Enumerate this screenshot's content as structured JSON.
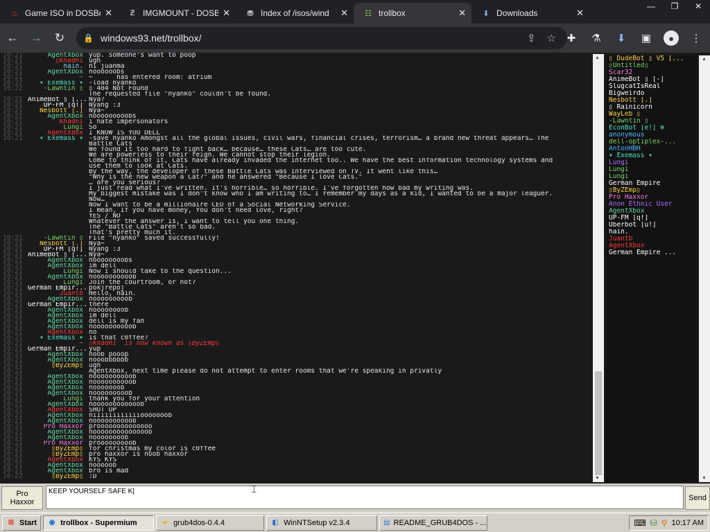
{
  "browser": {
    "tabs": [
      {
        "title": "Game ISO in DOSBo",
        "icon": "dosbox-favicon-icon",
        "active": false
      },
      {
        "title": "IMGMOUNT - DOSB",
        "icon": "dosbox-wiki-favicon-icon",
        "active": false
      },
      {
        "title": "Index of /isos/wind",
        "icon": "archive-favicon-icon",
        "active": false
      },
      {
        "title": "trollbox",
        "icon": "trollbox-favicon-icon",
        "active": true
      },
      {
        "title": "Downloads",
        "icon": "download-icon",
        "active": false
      }
    ],
    "url": "windows93.net/trollbox/"
  },
  "chat": [
    {
      "time": "10:21",
      "nick": "AgentXbox",
      "color": "#66d9a6",
      "msg": "yup. someone's want to poop"
    },
    {
      "time": "10:21",
      "nick": "▯Khadhi",
      "color": "#ff3b3b",
      "msg": "ugh"
    },
    {
      "time": "10:21",
      "nick": "hain.",
      "color": "#7fd3ff",
      "msg": "hi juanma"
    },
    {
      "time": "10:21",
      "nick": "AgentXbox",
      "color": "#66d9a6",
      "msg": "noooooobs"
    },
    {
      "time": "10:21",
      "nick": "~",
      "color": "#888888",
      "msg": "~      has entered room: atrium",
      "bold": "atrium"
    },
    {
      "time": "10:22",
      "nick": "▾ Exemass ▾",
      "color": "#50e3c2",
      "msg": "-load nyanko"
    },
    {
      "time": "10:22",
      "nick": "-Lawntin ▯",
      "color": "#7fd36b",
      "msg": "▯ 404 Not Found"
    },
    {
      "time": "",
      "nick": "",
      "color": "#ffffff",
      "msg": "The requested file \"nyanko\" couldn't be found."
    },
    {
      "time": "10:21",
      "nick": "AnimeBot ▯ [...",
      "color": "#ffffff",
      "msg": "Nya?"
    },
    {
      "time": "10:21",
      "nick": "UP-FM [q!]",
      "color": "#ffffff",
      "msg": "Nyang :3"
    },
    {
      "time": "10:21",
      "nick": "Nesbott [.]",
      "color": "#ffd24a",
      "msg": "Nya~"
    },
    {
      "time": "10:21",
      "nick": "AgentXbox",
      "color": "#66d9a6",
      "msg": "nooooooooobs"
    },
    {
      "time": "10:21",
      "nick": "Khadhi",
      "color": "#ff3b3b",
      "msg": "i hate impersonators"
    },
    {
      "time": "10:21",
      "nick": "Lungi",
      "color": "#7fd36b",
      "msg": "So"
    },
    {
      "time": "10:21",
      "nick": "AgentXbox",
      "color": "#ff3b3b",
      "msg": "I KNOW IS YOU DELL"
    },
    {
      "time": "10:21",
      "nick": "▾ Exemass ▾",
      "color": "#50e3c2",
      "msg": "-save nyanko Amongst all the global issues, civil wars, financial crises, terrorism… a brand new threat appears… The"
    },
    {
      "time": "",
      "nick": "",
      "color": "#ffffff",
      "msg": "Battle Cats"
    },
    {
      "time": "",
      "nick": "",
      "color": "#ffffff",
      "msg": "We found it too hard to fight back… because… these Cats… are too cute."
    },
    {
      "time": "",
      "nick": "",
      "color": "#ffffff",
      "msg": "We are powerless to their reign. We cannot stop their legion."
    },
    {
      "time": "",
      "nick": "",
      "color": "#ffffff",
      "msg": "Come to think of it, Cats have already invaded the internet too.. We have the best information technology systems and"
    },
    {
      "time": "",
      "nick": "",
      "color": "#ffffff",
      "msg": "use them to look at Cats."
    },
    {
      "time": "",
      "nick": "",
      "color": "#ffffff",
      "msg": "By the way, the developer of these Battle Cats was interviewed on TV. It went like this…"
    },
    {
      "time": "",
      "nick": "",
      "color": "#ffffff",
      "msg": "\"Why is the new weapon a Cat?\" and he answered \"Because I love Cats.\""
    },
    {
      "time": "",
      "nick": "",
      "color": "#ffffff",
      "msg": "… are you serious?"
    },
    {
      "time": "",
      "nick": "",
      "color": "#ffffff",
      "msg": "I just read what I've written. It's horrible… so horrible. I've forgotten how bad my writing was."
    },
    {
      "time": "",
      "nick": "",
      "color": "#ffffff",
      "msg": "My biggest mistake was I don't know who I am writing to… I remember my days as a kid, I wanted to be a major leaguer."
    },
    {
      "time": "",
      "nick": "",
      "color": "#ffffff",
      "msg": "Now…"
    },
    {
      "time": "",
      "nick": "",
      "color": "#ffffff",
      "msg": "Now I want to be a millionaire CEO of a Social Networking Service."
    },
    {
      "time": "",
      "nick": "",
      "color": "#ffffff",
      "msg": "I mean, If you have money, You don't need love, right?"
    },
    {
      "time": "",
      "nick": "",
      "color": "#ffffff",
      "msg": "YES / NO"
    },
    {
      "time": "",
      "nick": "",
      "color": "#ffffff",
      "msg": "Whatever the answer is, I want to tell you one thing."
    },
    {
      "time": "",
      "nick": "",
      "color": "#ffffff",
      "msg": "The \"Battle Cats\" aren't so bad."
    },
    {
      "time": "",
      "nick": "",
      "color": "#ffffff",
      "msg": "That's pretty much it."
    },
    {
      "time": "10:21",
      "nick": "-Lawntin ▯",
      "color": "#7fd36b",
      "msg": "File \"nyanko\" saved successfully!"
    },
    {
      "time": "10:21",
      "nick": "Nesbott [.]",
      "color": "#ffd24a",
      "msg": "Nya~"
    },
    {
      "time": "10:21",
      "nick": "UP-FM [q!]",
      "color": "#ffffff",
      "msg": "Nyang :3"
    },
    {
      "time": "10:21",
      "nick": "AnimeBot ▯ [...",
      "color": "#ffffff",
      "msg": "Nya~"
    },
    {
      "time": "10:21",
      "nick": "AgentXbox",
      "color": "#66d9a6",
      "msg": "noooooooobs"
    },
    {
      "time": "10:21",
      "nick": "AgentXbox",
      "color": "#66d9a6",
      "msg": "im dell"
    },
    {
      "time": "10:21",
      "nick": "Lungi",
      "color": "#7fd36b",
      "msg": "Now i should take to the question..."
    },
    {
      "time": "10:21",
      "nick": "AgentXbox",
      "color": "#66d9a6",
      "msg": "noooooooooob"
    },
    {
      "time": "10:21",
      "nick": "Lungi",
      "color": "#7fd36b",
      "msg": "Join the courtroom, or not?"
    },
    {
      "time": "10:21",
      "nick": "German Empir...",
      "color": "#ffffff",
      "msg": "pokjrepoj"
    },
    {
      "time": "10:21",
      "nick": "Juantb",
      "color": "#ff3b3b",
      "msg": "Hello, hain."
    },
    {
      "time": "10:21",
      "nick": "AgentXbox",
      "color": "#66d9a6",
      "msg": "nooooooooob"
    },
    {
      "time": "10:21",
      "nick": "German Empir...",
      "color": "#ffffff",
      "msg": "there"
    },
    {
      "time": "10:21",
      "nick": "AgentXbox",
      "color": "#66d9a6",
      "msg": "noooooooob"
    },
    {
      "time": "10:21",
      "nick": "AgentXbox",
      "color": "#66d9a6",
      "msg": "im dell"
    },
    {
      "time": "10:21",
      "nick": "AgentXbox",
      "color": "#66d9a6",
      "msg": "dell is my fan"
    },
    {
      "time": "10:21",
      "nick": "AgentXbox",
      "color": "#66d9a6",
      "msg": "noooooooooob"
    },
    {
      "time": "10:21",
      "nick": "AgentXbox",
      "color": "#ff3b3b",
      "msg": "no"
    },
    {
      "time": "10:21",
      "nick": "▾ Exemass ▾",
      "color": "#50e3c2",
      "msg": "is that c0ffee?"
    },
    {
      "time": "10:21",
      "nick": "~",
      "color": "#888888",
      "msg": "▯Khadhi  is now known as ▯ByZEmp▯",
      "italic": true
    },
    {
      "time": "10:21",
      "nick": "German Empir...",
      "color": "#ffffff",
      "msg": "yup"
    },
    {
      "time": "10:21",
      "nick": "AgentXbox",
      "color": "#66d9a6",
      "msg": "noob pooop"
    },
    {
      "time": "10:21",
      "nick": "AgentXbox",
      "color": "#66d9a6",
      "msg": "nooobbbbbb"
    },
    {
      "time": "10:21",
      "nick": "▯ByZEmp▯",
      "color": "#ffd24a",
      "msg": "ugh"
    },
    {
      "time": "10:21",
      "nick": "",
      "color": "#ffffff",
      "msg": "AgentXbox, next time please do not attempt to enter rooms that we're speaking in privatly"
    },
    {
      "time": "10:21",
      "nick": "AgentXbox",
      "color": "#66d9a6",
      "msg": "noooooooooob"
    },
    {
      "time": "10:21",
      "nick": "AgentXbox",
      "color": "#66d9a6",
      "msg": "noooooooooob"
    },
    {
      "time": "10:21",
      "nick": "AgentXbox",
      "color": "#66d9a6",
      "msg": "nooooooob"
    },
    {
      "time": "10:21",
      "nick": "AgentXbox",
      "color": "#66d9a6",
      "msg": "nooooooooob"
    },
    {
      "time": "10:21",
      "nick": "Lungi",
      "color": "#7fd36b",
      "msg": "thank you for your attention"
    },
    {
      "time": "10:21",
      "nick": "AgentXbox",
      "color": "#66d9a6",
      "msg": "noooooooooooob"
    },
    {
      "time": "10:21",
      "nick": "AgentXbox",
      "color": "#ff3b3b",
      "msg": "SHUT UP"
    },
    {
      "time": "10:21",
      "nick": "AgentXbox",
      "color": "#66d9a6",
      "msg": "niiiiiiiiiiiiooooooob"
    },
    {
      "time": "10:21",
      "nick": "AgentXbox",
      "color": "#66d9a6",
      "msg": "noooooooooob"
    },
    {
      "time": "10:21",
      "nick": "Pro Haxxor",
      "color": "#ff7be0",
      "msg": "proooooooooooooo"
    },
    {
      "time": "10:21",
      "nick": "AgentXbox",
      "color": "#66d9a6",
      "msg": "noooooooooooooob"
    },
    {
      "time": "10:21",
      "nick": "AgentXbox",
      "color": "#66d9a6",
      "msg": "noooooooob"
    },
    {
      "time": "10:21",
      "nick": "Pro Haxxor",
      "color": "#ff7be0",
      "msg": "prooooooooob"
    },
    {
      "time": "10:21",
      "nick": "▯ByZEmp▯",
      "color": "#ffd24a",
      "msg": "for christmas my color is c0ffee"
    },
    {
      "time": "10:21",
      "nick": "▯ByZEmp▯",
      "color": "#ffd24a",
      "msg": "pro haxxor is noob haxxor"
    },
    {
      "time": "10:21",
      "nick": "AgentXbox",
      "color": "#ff3b3b",
      "msg": "KYS KYS"
    },
    {
      "time": "10:21",
      "nick": "AgentXbox",
      "color": "#66d9a6",
      "msg": "nooooob"
    },
    {
      "time": "10:21",
      "nick": "AgentXbox",
      "color": "#66d9a6",
      "msg": "bro is mad"
    },
    {
      "time": "10:22",
      "nick": "▯ByZEmp▯",
      "color": "#ffd24a",
      "msg": ":D"
    }
  ],
  "users": [
    {
      "name": "▯ DudeBot ▯ V5 [...",
      "color": "#ffd24a"
    },
    {
      "name": "▯Untitled▯",
      "color": "#7fd36b"
    },
    {
      "name": "Scar32",
      "color": "#ff7be0"
    },
    {
      "name": "AnimeBot ▯ [-]",
      "color": "#ffffff"
    },
    {
      "name": "SlugcatIsReal",
      "color": "#ffffff"
    },
    {
      "name": "Bigweirdo",
      "color": "#ffffff"
    },
    {
      "name": "Nesbott [.]",
      "color": "#ffd24a"
    },
    {
      "name": "▯ Rainicorn",
      "color": "#ffffff"
    },
    {
      "name": "WayLeb ▯",
      "color": "#ffd24a"
    },
    {
      "name": "-Lawntin ▯",
      "color": "#7fd36b"
    },
    {
      "name": "EconBot [e!] ❄",
      "color": "#50e3c2"
    },
    {
      "name": "anonymous",
      "color": "#4db6ff"
    },
    {
      "name": "dell-optiplex-...",
      "color": "#7fd36b"
    },
    {
      "name": "AntonHBH",
      "color": "#4db6ff"
    },
    {
      "name": "▾ Exemass ▾",
      "color": "#50e3c2"
    },
    {
      "name": "Lungi",
      "color": "#b06cff"
    },
    {
      "name": "Lungi",
      "color": "#7fd36b"
    },
    {
      "name": "Lungi",
      "color": "#7fd36b"
    },
    {
      "name": "German Empire",
      "color": "#ffffff"
    },
    {
      "name": "▯ByZEmp▯",
      "color": "#ffd24a"
    },
    {
      "name": "Pro Haxxor",
      "color": "#ff7be0"
    },
    {
      "name": "Anon Ethnic User",
      "color": "#b06cff"
    },
    {
      "name": "AgentXbox",
      "color": "#66d9a6"
    },
    {
      "name": "UP-FM [q!]",
      "color": "#ffffff"
    },
    {
      "name": "Uberbot [u!]",
      "color": "#ffffff"
    },
    {
      "name": "hain.",
      "color": "#ffffff"
    },
    {
      "name": "Juantb",
      "color": "#ff3b3b"
    },
    {
      "name": "AgentXbox",
      "color": "#ff3b3b"
    },
    {
      "name": "German Empire ...",
      "color": "#ffffff"
    }
  ],
  "input": {
    "nick_label_1": "Pro",
    "nick_label_2": "Haxxor",
    "value": "KEEP YOURSELF SAFE K|",
    "send_label": "Send"
  },
  "taskbar": {
    "start_label": "Start",
    "items": [
      {
        "label": "trollbox - Supermium",
        "icon": "supermium-icon",
        "active": true
      },
      {
        "label": "grub4dos-0.4.4",
        "icon": "folder-icon",
        "active": false
      },
      {
        "label": "WinNTSetup v2.3.4",
        "icon": "setup-app-icon",
        "active": false
      },
      {
        "label": "README_GRUB4DOS - ...",
        "icon": "notepad-icon",
        "active": false
      }
    ],
    "clock": "10:17 AM"
  }
}
